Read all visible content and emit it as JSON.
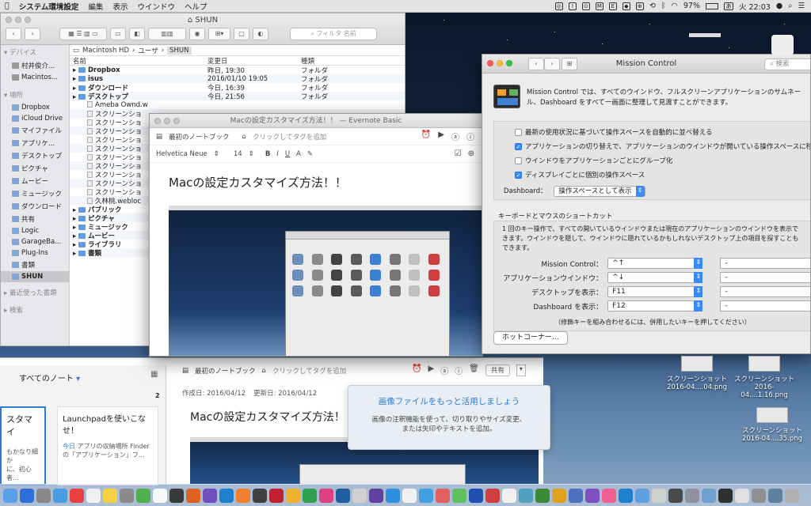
{
  "menubar": {
    "app": "システム環境設定",
    "items": [
      "編集",
      "表示",
      "ウインドウ",
      "ヘルプ"
    ],
    "battery": "97%",
    "input": "あ",
    "clock": "火 22:03"
  },
  "finder": {
    "title": "SHUN",
    "search_placeholder": "フィルタ 名前",
    "sidebar": {
      "devices_header": "デバイス",
      "devices": [
        "村井俊介...",
        "Macintos..."
      ],
      "places_header": "場所",
      "places": [
        "Dropbox",
        "iCloud Drive",
        "マイファイル",
        "アプリケ...",
        "デスクトップ",
        "ピクチャ",
        "ムービー",
        "ミュージック",
        "ダウンロード",
        "共有",
        "Logic",
        "GarageBa...",
        "Plug-Ins",
        "書類",
        "SHUN"
      ],
      "recent": "最近使った書類",
      "search": "検索"
    },
    "path": [
      "Macintosh HD",
      "ユーザ",
      "SHUN"
    ],
    "columns": [
      "名前",
      "変更日",
      "種類"
    ],
    "rows": [
      {
        "name": "Dropbox",
        "date": "昨日, 19:30",
        "kind": "フォルダ",
        "folder": true
      },
      {
        "name": "isus",
        "date": "2016/01/10 19:05",
        "kind": "フォルダ",
        "folder": true
      },
      {
        "name": "ダウンロード",
        "date": "今日, 16:39",
        "kind": "フォルダ",
        "folder": true
      },
      {
        "name": "デスクトップ",
        "date": "今日, 21:56",
        "kind": "フォルダ",
        "folder": true
      },
      {
        "name": "Ameba Ownd.w",
        "date": "",
        "kind": "",
        "folder": false
      },
      {
        "name": "スクリーンショ",
        "date": "",
        "kind": "",
        "folder": false
      },
      {
        "name": "スクリーンショ",
        "date": "",
        "kind": "",
        "folder": false
      },
      {
        "name": "スクリーンショ",
        "date": "",
        "kind": "",
        "folder": false
      },
      {
        "name": "スクリーンショ",
        "date": "",
        "kind": "",
        "folder": false
      },
      {
        "name": "スクリーンショ",
        "date": "",
        "kind": "",
        "folder": false
      },
      {
        "name": "スクリーンショ",
        "date": "",
        "kind": "",
        "folder": false
      },
      {
        "name": "スクリーンショ",
        "date": "",
        "kind": "",
        "folder": false
      },
      {
        "name": "スクリーンショ",
        "date": "",
        "kind": "",
        "folder": false
      },
      {
        "name": "スクリーンショ",
        "date": "",
        "kind": "",
        "folder": false
      },
      {
        "name": "スクリーンショ",
        "date": "",
        "kind": "",
        "folder": false
      },
      {
        "name": "久林桃.webloc",
        "date": "",
        "kind": "",
        "folder": false
      },
      {
        "name": "パブリック",
        "date": "",
        "kind": "",
        "folder": true
      },
      {
        "name": "ピクチャ",
        "date": "",
        "kind": "",
        "folder": true
      },
      {
        "name": "ミュージック",
        "date": "",
        "kind": "",
        "folder": true
      },
      {
        "name": "ムービー",
        "date": "",
        "kind": "",
        "folder": true
      },
      {
        "name": "ライブラリ",
        "date": "",
        "kind": "",
        "folder": true
      },
      {
        "name": "書類",
        "date": "",
        "kind": "",
        "folder": true
      }
    ]
  },
  "evernote": {
    "title": "Macの設定カスタマイズ方法！！ — Evernote Basic",
    "notebook": "最初のノートブック",
    "tag_hint": "クリックしてタグを追加",
    "font": "Helvetica Neue",
    "size": "14",
    "note_title": "Macの設定カスタマイズ方法！！"
  },
  "evernote_back": {
    "all_notes": "すべてのノート",
    "count": "2",
    "notebook": "最初のノートブック",
    "tag_hint": "クリックしてタグを追加",
    "share": "共有",
    "created": "作成日: 2016/04/12",
    "updated": "更新日: 2016/04/12",
    "note_title": "Macの設定カスタマイズ方法！",
    "card1_title": "スタマイ",
    "card1_body": "もかなり細か\nに、初心者...",
    "card2_title": "Launchpadを使いこなせ！",
    "card2_body_blue": "今日",
    "card2_body": " アプリの収納場所 Finder の「アプリケーション」フ..."
  },
  "tooltip": {
    "title": "画像ファイルをもっと活用しましょう",
    "body": "画像の注釈機能を使って、切り取りやサイズ変更、\nまたは矢印やテキストを追加。"
  },
  "mission": {
    "title": "Mission Control",
    "search": "検索",
    "desc": "Mission Control では、すべてのウインドウ、フルスクリーンアプリケーションのサムネール、Dashboard をすべて一画面に整理して見渡すことができます。",
    "options": [
      {
        "label": "最新の使用状況に基づいて操作スペースを自動的に並べ替える",
        "on": false
      },
      {
        "label": "アプリケーションの切り替えで、アプリケーションのウインドウが開いている操作スペースに移動",
        "on": true
      },
      {
        "label": "ウインドウをアプリケーションごとにグループ化",
        "on": false
      },
      {
        "label": "ディスプレイごとに個別の操作スペース",
        "on": true
      }
    ],
    "dashboard_label": "Dashboard：",
    "dashboard_value": "操作スペースとして表示",
    "shortcut_header": "キーボードとマウスのショートカット",
    "shortcut_desc": "1 回のキー操作で、すべての開いているウインドウまたは現在のアプリケーションのウインドウを表示できます。ウインドウを隠して、ウインドウに隠れているかもしれないデスクトップ上の項目を探すこともできます。",
    "shortcuts": [
      {
        "label": "Mission Control：",
        "key": "^↑",
        "mouse": "-"
      },
      {
        "label": "アプリケーションウインドウ：",
        "key": "^↓",
        "mouse": "-"
      },
      {
        "label": "デスクトップを表示：",
        "key": "F11",
        "mouse": "-"
      },
      {
        "label": "Dashboard を表示：",
        "key": "F12",
        "mouse": "-"
      }
    ],
    "hint": "（修飾キーを組み合わせるには、併用したいキーを押してください）",
    "hot_corners": "ホットコーナー..."
  },
  "desktop": [
    {
      "label": "スクリーンショット\n2016-04....04.png"
    },
    {
      "label": "スクリーンショット\n2016-04....1.16.png"
    },
    {
      "label": "スクリーンショット\n2016-04....35.png"
    }
  ],
  "colors": {
    "accent": "#3b8af6",
    "evernote_blue": "#2c7cd1"
  }
}
